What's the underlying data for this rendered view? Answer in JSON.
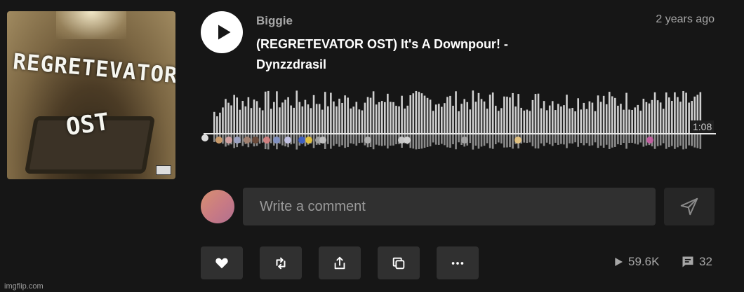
{
  "track": {
    "artist": "Biggie",
    "title": "(REGRETEVATOR OST) It's A Downpour! - Dynzzdrasil",
    "posted": "2 years ago",
    "duration": "1:08",
    "artwork_text": {
      "title": "REGRETEVATOR",
      "subtitle": "OST"
    }
  },
  "comment": {
    "placeholder": "Write a comment"
  },
  "actions": [
    "like",
    "repost",
    "share",
    "copy-link",
    "more"
  ],
  "stats": {
    "plays": "59.6K",
    "comments": "32"
  },
  "watermark": "imgflip.com",
  "colors": {
    "background": "#161616",
    "button": "#303030",
    "waveform": "#cfcfcf",
    "text_muted": "#a7a7a7"
  },
  "icons": {
    "play": "play-icon",
    "send": "send-icon",
    "like": "heart-icon",
    "repost": "repost-icon",
    "share": "share-icon",
    "copy": "copy-icon",
    "more": "more-icon",
    "plays": "play-count-icon",
    "comments": "comment-icon"
  }
}
